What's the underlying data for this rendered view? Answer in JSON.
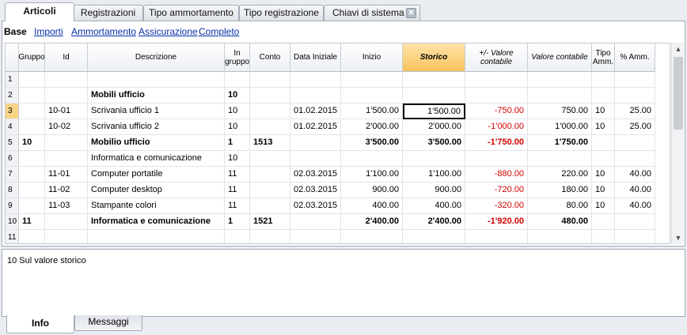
{
  "tabs": [
    {
      "label": "Articoli",
      "active": true
    },
    {
      "label": "Registrazioni"
    },
    {
      "label": "Tipo ammortamento"
    },
    {
      "label": "Tipo registrazione"
    },
    {
      "label": "Chiavi di sistema",
      "closable": true
    }
  ],
  "close_glyph": "✕",
  "views": {
    "active": "Base",
    "links": [
      "Importi",
      "Ammortamento",
      "Assicurazione",
      "Completo"
    ]
  },
  "columns": [
    "",
    "Gruppo",
    "Id",
    "Descrizione",
    "In gruppo",
    "Conto",
    "Data Iniziale",
    "Inizio",
    "Storico",
    "+/- Valore contabile",
    "Valore contabile",
    "Tipo Amm.",
    "% Amm."
  ],
  "highlighted_column": "Storico",
  "rows": [
    {
      "n": "1",
      "cells": [
        "",
        "",
        "",
        "",
        "",
        "",
        "",
        "",
        "",
        "",
        "",
        ""
      ]
    },
    {
      "n": "2",
      "cells": [
        "",
        "",
        "Mobili ufficio",
        "10",
        "",
        "",
        "",
        "",
        "",
        "",
        "",
        ""
      ],
      "bold": [
        2,
        3
      ]
    },
    {
      "n": "3",
      "cells": [
        "",
        "10-01",
        "Scrivania ufficio 1",
        "10",
        "",
        "01.02.2015",
        "1'500.00",
        "1'500.00",
        "-750.00",
        "750.00",
        "10",
        "25.00"
      ],
      "selected": true
    },
    {
      "n": "4",
      "cells": [
        "",
        "10-02",
        "Scrivania ufficio 2",
        "10",
        "",
        "01.02.2015",
        "2'000.00",
        "2'000.00",
        "-1'000.00",
        "1'000.00",
        "10",
        "25.00"
      ]
    },
    {
      "n": "5",
      "cells": [
        "10",
        "",
        "Mobilio ufficio",
        "1",
        "1513",
        "",
        "3'500.00",
        "3'500.00",
        "-1'750.00",
        "1'750.00",
        "",
        ""
      ],
      "bold": [
        0,
        2,
        3,
        4,
        6,
        7,
        8,
        9
      ]
    },
    {
      "n": "6",
      "cells": [
        "",
        "",
        "Informatica e comunicazione",
        "10",
        "",
        "",
        "",
        "",
        "",
        "",
        "",
        ""
      ]
    },
    {
      "n": "7",
      "cells": [
        "",
        "11-01",
        "Computer portatile",
        "11",
        "",
        "02.03.2015",
        "1'100.00",
        "1'100.00",
        "-880.00",
        "220.00",
        "10",
        "40.00"
      ]
    },
    {
      "n": "8",
      "cells": [
        "",
        "11-02",
        "Computer desktop",
        "11",
        "",
        "02.03.2015",
        "900.00",
        "900.00",
        "-720.00",
        "180.00",
        "10",
        "40.00"
      ]
    },
    {
      "n": "9",
      "cells": [
        "",
        "11-03",
        "Stampante colori",
        "11",
        "",
        "02.03.2015",
        "400.00",
        "400.00",
        "-320.00",
        "80.00",
        "10",
        "40.00"
      ]
    },
    {
      "n": "10",
      "cells": [
        "11",
        "",
        "Informatica e comunicazione",
        "1",
        "1521",
        "",
        "2'400.00",
        "2'400.00",
        "-1'920.00",
        "480.00",
        "",
        ""
      ],
      "bold": [
        0,
        2,
        3,
        4,
        6,
        7,
        8,
        9
      ]
    },
    {
      "n": "11",
      "cells": [
        "",
        "",
        "",
        "",
        "",
        "",
        "",
        "",
        "",
        "",
        "",
        ""
      ]
    }
  ],
  "info_text": "10 Sul valore storico",
  "bottom_tabs": [
    {
      "label": "Info",
      "active": true
    },
    {
      "label": "Messaggi"
    }
  ],
  "scroll_up_glyph": "▲",
  "scroll_down_glyph": "▼",
  "colors": {
    "negative": "#d40000",
    "highlight_column": "#f7c35f",
    "link": "#0b2fa8"
  }
}
